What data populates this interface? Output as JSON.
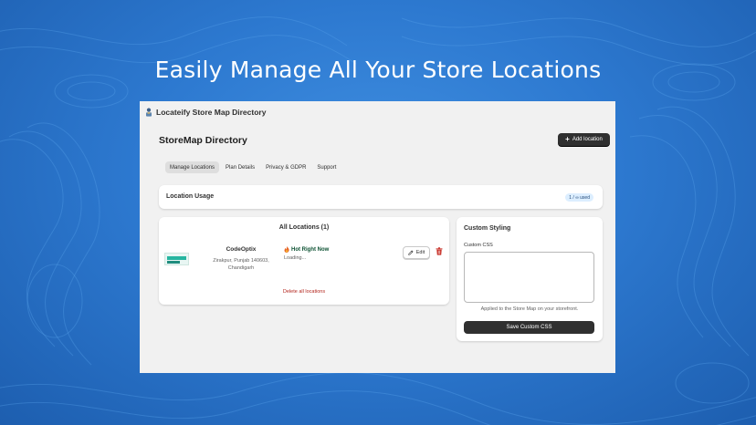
{
  "banner": {
    "headline": "Easily Manage All Your Store  Locations"
  },
  "app": {
    "title": "Locateify Store Map Directory",
    "logo_icon": "store-person-icon",
    "page_title": "StoreMap Directory",
    "add_location_label": "Add location",
    "tabs": [
      {
        "label": "Manage Locations",
        "active": true
      },
      {
        "label": "Plan Details",
        "active": false
      },
      {
        "label": "Privacy & GDPR",
        "active": false
      },
      {
        "label": "Support",
        "active": false
      }
    ],
    "usage": {
      "title": "Location Usage",
      "badge": "1 / ∞ used"
    },
    "locations": {
      "title": "All Locations (1)",
      "items": [
        {
          "name": "CodeOptix",
          "address_line1": "Zirakpur, Punjab 140603,",
          "address_line2": "Chandigarh",
          "status": "Hot Right Now",
          "status_detail": "Loading...",
          "edit_label": "Edit"
        }
      ],
      "delete_all_label": "Delete all locations"
    },
    "custom_styling": {
      "title": "Custom Styling",
      "css_label": "Custom CSS",
      "css_value": "",
      "help_text": "Applied to the Store Map on your storefront.",
      "save_label": "Save Custom CSS"
    }
  },
  "colors": {
    "background_blue": "#2d79d0",
    "primary_button": "#303030",
    "danger": "#b3261e",
    "success_text": "#0c5132",
    "badge_bg": "#dceeff"
  }
}
